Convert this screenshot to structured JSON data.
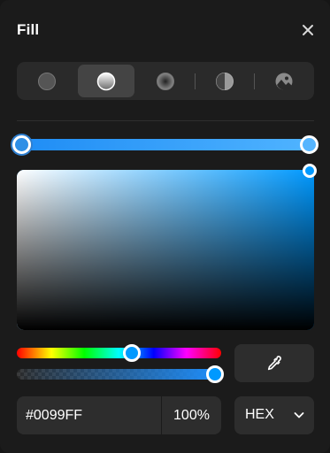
{
  "panel": {
    "title": "Fill",
    "close_icon": "close-icon"
  },
  "fill_types": [
    {
      "icon": "solid-fill-icon",
      "active": false
    },
    {
      "icon": "linear-gradient-icon",
      "active": true
    },
    {
      "icon": "radial-gradient-icon",
      "active": false
    },
    {
      "icon": "angular-gradient-icon",
      "active": false
    },
    {
      "icon": "image-fill-icon",
      "active": false
    }
  ],
  "gradient": {
    "stops": [
      {
        "color": "#2E8FE6",
        "position": 0,
        "selected": true
      },
      {
        "color": "#55B5FF",
        "position": 1,
        "selected": false
      }
    ]
  },
  "picker": {
    "hue_color": "#0099FF",
    "hue_position": 0.56,
    "alpha_position": 1.0,
    "eyedropper_icon": "eyedropper-icon"
  },
  "color_value": {
    "hex": "#0099FF",
    "alpha": "100%",
    "format": "HEX",
    "format_icon": "chevron-down-icon"
  }
}
